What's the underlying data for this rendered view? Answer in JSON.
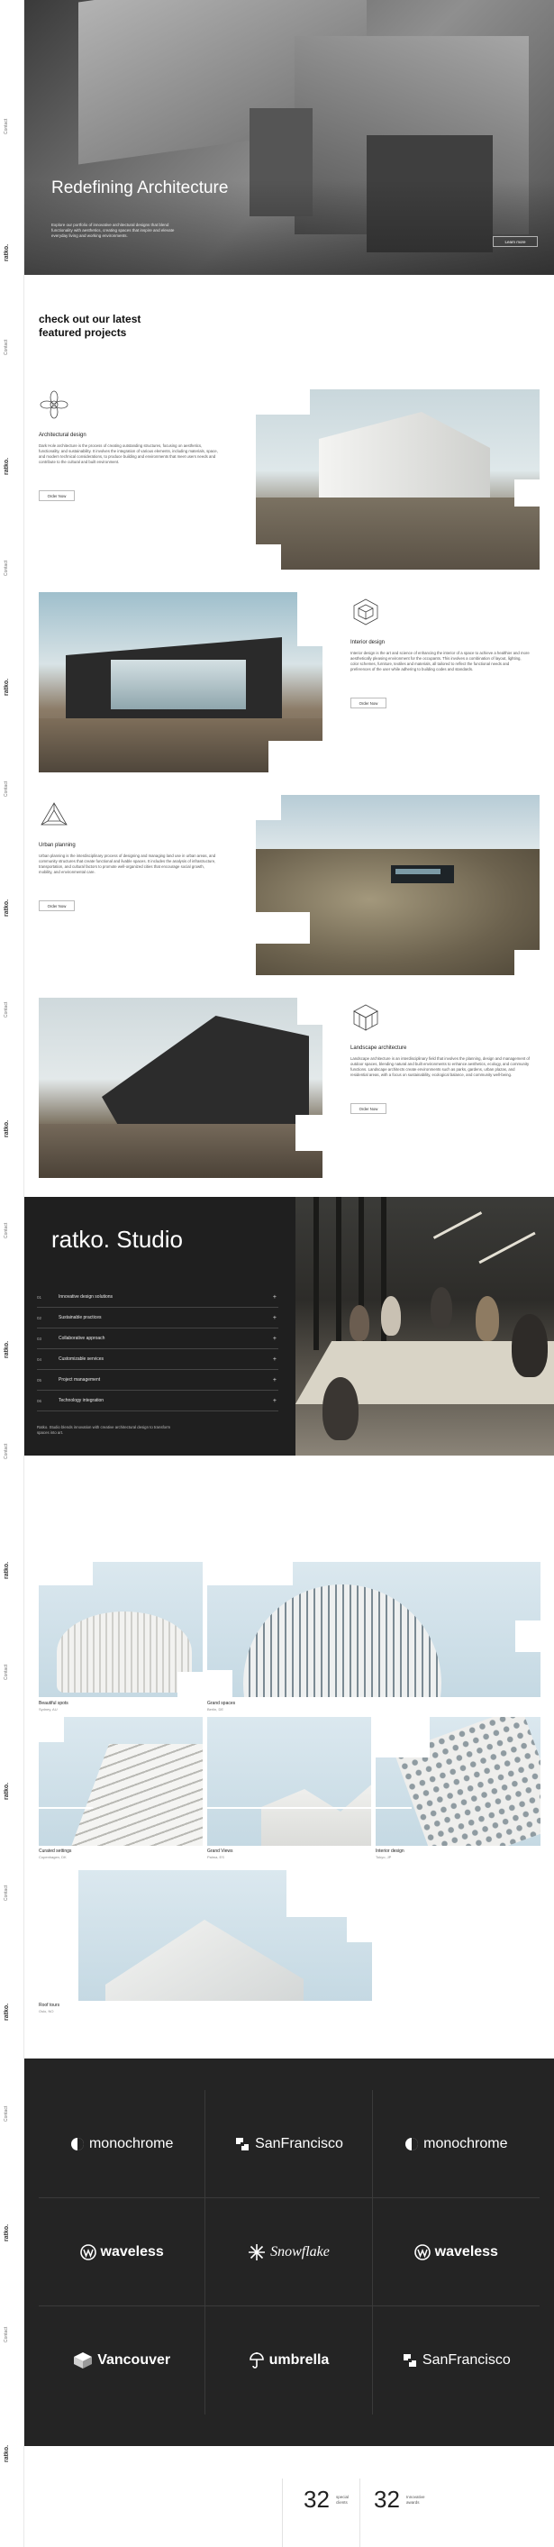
{
  "rail": {
    "contact_label": "Contact",
    "logo_text": "ratko."
  },
  "hero": {
    "title": "Redefining Architecture",
    "description": "Explore our portfolio of innovative architectural designs that blend functionality with aesthetics, creating spaces that inspire and elevate everyday living and working environments.",
    "button_label": "Learn more"
  },
  "projects_heading": "check out our latest featured projects",
  "projects": [
    {
      "title": "Architectural design",
      "description": "Dark Hole architecture is the process of creating outstanding structures, focusing on aesthetics, functionality, and sustainability. It involves the integration of various elements, including materials, space, and modern technical considerations, to produce building and environments that meet users needs and contribute to the cultural and built environment.",
      "button_label": "Order Now",
      "icon": "flower-outline-icon"
    },
    {
      "title": "Interior design",
      "description": "Interior design is the art and science of enhancing the interior of a space to achieve a healthier and more aesthetically pleasing environment for the occupants. This involves a combination of layout, lighting, color schemes, furniture, textiles and materials, all tailored to reflect the functional needs and preferences of the user while adhering to building codes and standards.",
      "button_label": "Order Now",
      "icon": "hexagon-cube-icon"
    },
    {
      "title": "Urban planning",
      "description": "Urban planning is the interdisciplinary process of designing and managing land use in urban areas, and community structures that create functional and livable spaces. It includes the analysis of infrastructure, transportation, and cultural factors to promote well-organized cities that encourage social growth, mobility, and environmental care.",
      "button_label": "Order Now",
      "icon": "geometric-triangle-icon"
    },
    {
      "title": "Landscape architecture",
      "description": "Landscape architecture is an interdisciplinary field that involves the planning, design and management of outdoor spaces, blending natural and built environments to enhance aesthetics, ecology, and community functions. Landscape architects create environments such as parks, gardens, urban plazas, and residential areas, with a focus on sustainability, ecological balance, and community well-being.",
      "button_label": "Order Now",
      "icon": "isometric-cube-icon"
    }
  ],
  "studio": {
    "title": "ratko. Studio",
    "items": [
      {
        "num": "01",
        "label": "Innovative design solutions"
      },
      {
        "num": "02",
        "label": "Sustainable practices"
      },
      {
        "num": "03",
        "label": "Collaborative approach"
      },
      {
        "num": "04",
        "label": "Customizable services"
      },
      {
        "num": "05",
        "label": "Project management"
      },
      {
        "num": "06",
        "label": "Technology integration"
      }
    ],
    "note": "Ratko. Studio blends innovation with creative architectural design to transform spaces into art."
  },
  "gallery": [
    {
      "name": "Beautiful spots",
      "sub": "Sydney, AU"
    },
    {
      "name": "Grand spaces",
      "sub": "Berlin, DE"
    },
    {
      "name": "Curated settings",
      "sub": "Copenhagen, DK"
    },
    {
      "name": "Grand Views",
      "sub": "Palma, ES"
    },
    {
      "name": "Interior design",
      "sub": "Tokyo, JP"
    },
    {
      "name": "Roof tours",
      "sub": "Oslo, NO"
    }
  ],
  "logos": [
    {
      "name": "monochrome",
      "icon": "monochrome-logo-icon"
    },
    {
      "name": "SanFrancisco",
      "icon": "sanfrancisco-logo-icon"
    },
    {
      "name": "monochrome",
      "icon": "monochrome-logo-icon"
    },
    {
      "name": "waveless",
      "icon": "waveless-logo-icon"
    },
    {
      "name": "Snowflake",
      "icon": "snowflake-logo-icon"
    },
    {
      "name": "waveless",
      "icon": "waveless-logo-icon"
    },
    {
      "name": "Vancouver",
      "icon": "vancouver-logo-icon"
    },
    {
      "name": "umbrella",
      "icon": "umbrella-logo-icon"
    },
    {
      "name": "SanFrancisco",
      "icon": "sanfrancisco-logo-icon"
    }
  ],
  "stats": [
    {
      "value": "32",
      "label": "special clients"
    },
    {
      "value": "32",
      "label": "Innovative awards"
    }
  ],
  "colors": {
    "dark": "#1f1f1f",
    "logo_bg": "#242424",
    "sky": "#dbe8ef"
  }
}
